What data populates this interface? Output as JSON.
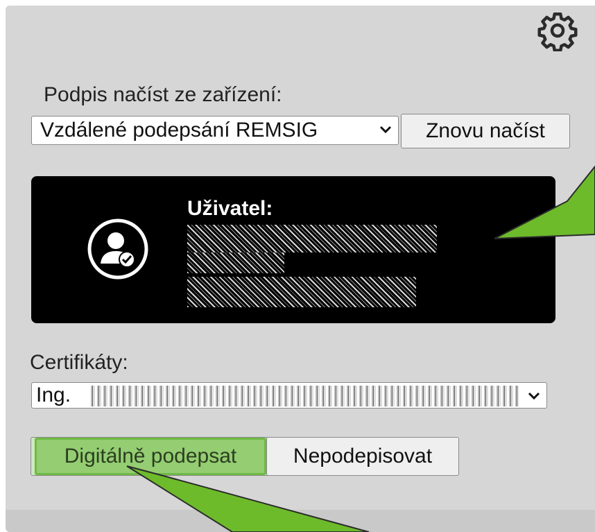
{
  "source_label": "Podpis načíst ze zařízení:",
  "device_select": {
    "value": "Vzdálené podepsání REMSIG"
  },
  "reload_button": "Znovu načíst",
  "user_card": {
    "title": "Uživatel:"
  },
  "certs_label": "Certifikáty:",
  "cert_select": {
    "value": "Ing."
  },
  "sign_button": "Digitálně podepsat",
  "no_sign_button": "Nepodepisovat",
  "colors": {
    "highlight": "#8fd16a",
    "arrow": "#6dbb2b",
    "card": "#000000",
    "panel": "#d6d6d6"
  },
  "icons": [
    "gear-icon",
    "chevron-down-icon",
    "user-check-icon"
  ]
}
